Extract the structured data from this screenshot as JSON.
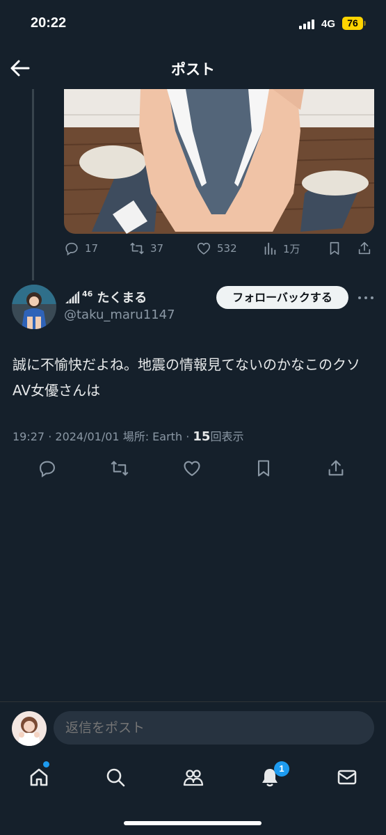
{
  "status_bar": {
    "time": "20:22",
    "network": "4G",
    "battery": "76",
    "colors": {
      "battery": "#ffd400"
    }
  },
  "header": {
    "title": "ポスト",
    "back_icon": "arrow-left-icon"
  },
  "quoted_post": {
    "media_icon": "photo",
    "actions": {
      "replies": "17",
      "reposts": "37",
      "likes": "532",
      "views": "1万"
    }
  },
  "post": {
    "display_name": "たくまる",
    "name_badge_superscript": "46",
    "handle": "@taku_maru1147",
    "follow_button": "フォローバックする",
    "text": "誠に不愉快だよね。地震の情報見てないのかなこのクソAV女優さんは",
    "meta": {
      "time": "19:27",
      "separator": "·",
      "date": "2024/01/01",
      "location_label": "場所: Earth",
      "views_count": "15",
      "views_label": "回表示"
    }
  },
  "reply_bar": {
    "placeholder": "返信をポスト"
  },
  "bottom_nav": {
    "items": [
      "home-icon",
      "search-icon",
      "communities-icon",
      "notifications-icon",
      "messages-icon"
    ],
    "notification_badge": "1"
  },
  "colors": {
    "background": "#15202b",
    "accent": "#1d9bf0",
    "secondary_text": "#8b98a5"
  }
}
